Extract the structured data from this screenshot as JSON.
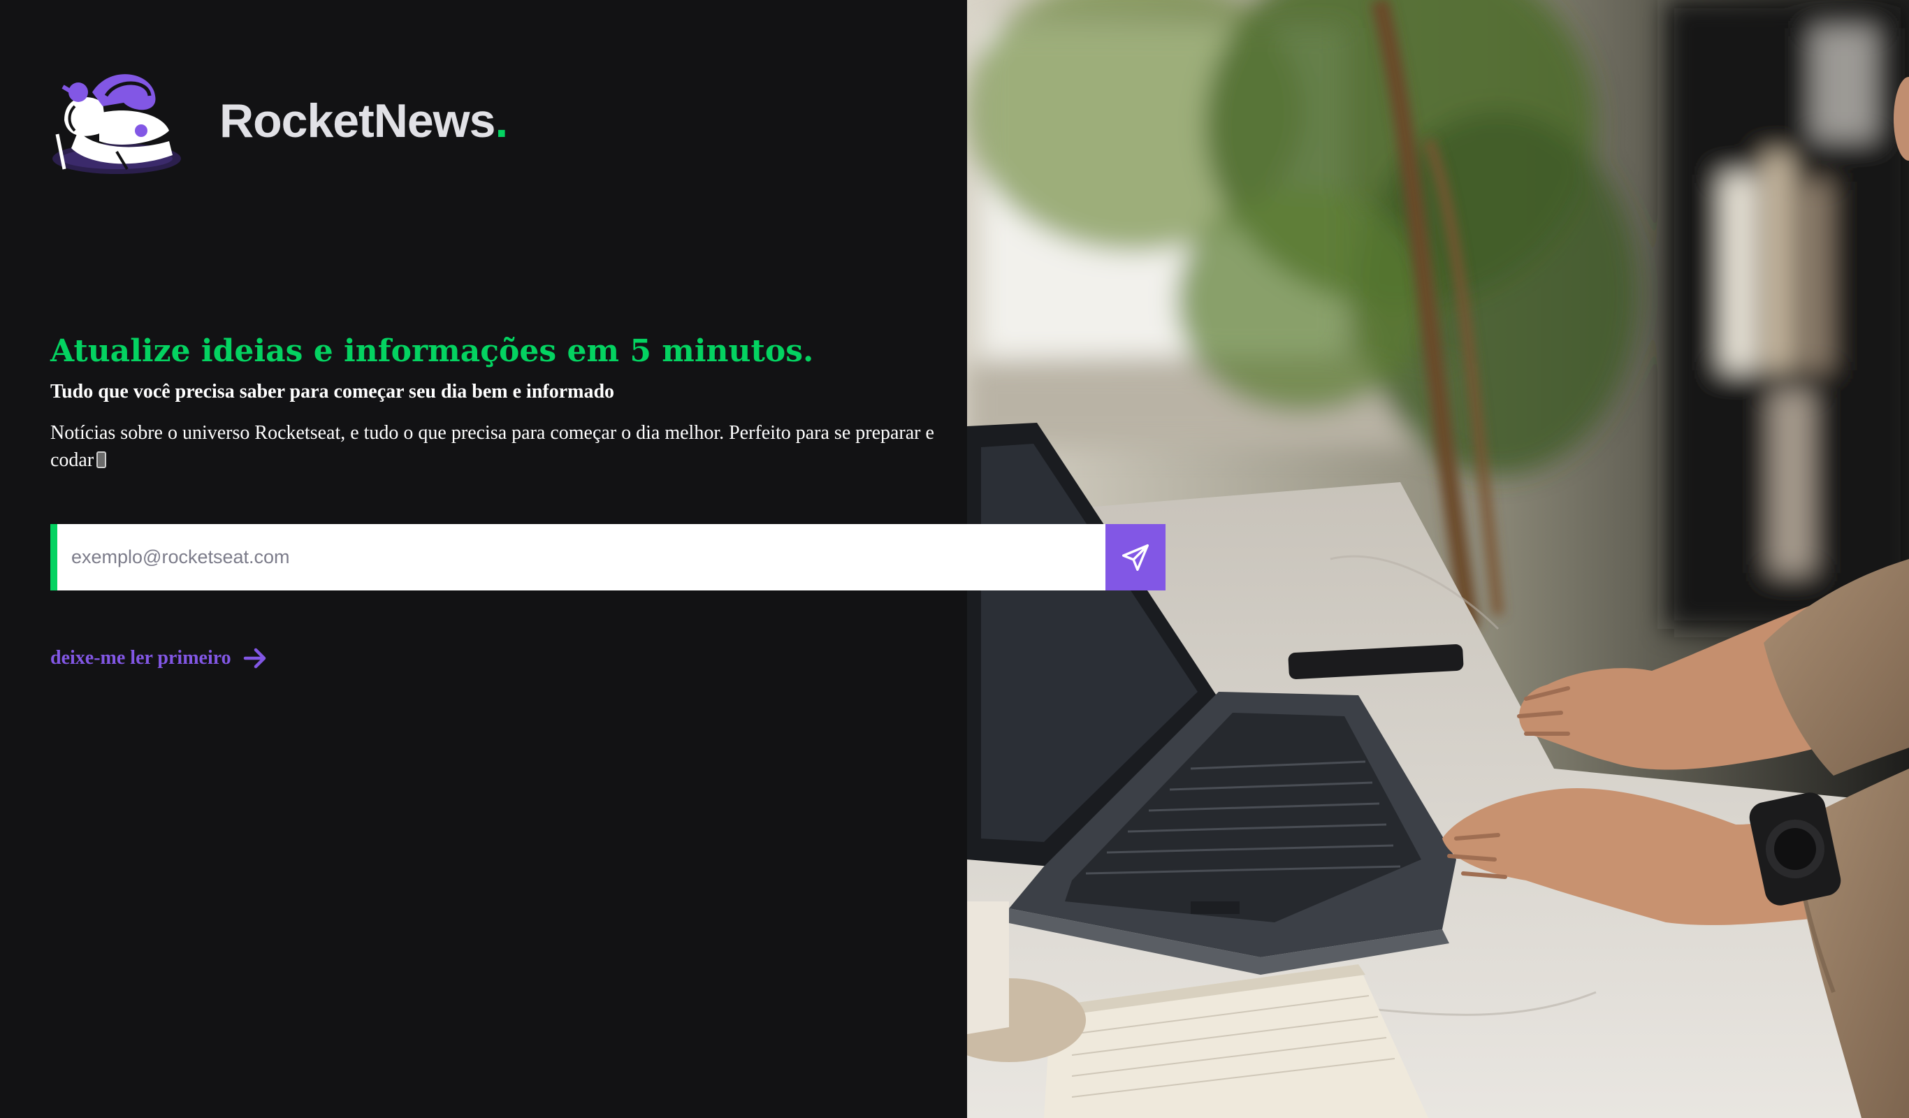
{
  "brand": {
    "name": "RocketNews",
    "dot": "."
  },
  "hero": {
    "headline": "Atualize ideias e informações em 5 minutos.",
    "subheadline": "Tudo que você precisa saber para começar seu dia bem e informado",
    "description": "Notícias sobre o universo Rocketseat, e tudo o que precisa para começar o dia melhor. Perfeito para se preparar e codar"
  },
  "form": {
    "email_placeholder": "exemplo@rocketseat.com",
    "email_value": "",
    "submit_icon": "send-icon"
  },
  "links": {
    "read_first": "deixe-me ler primeiro",
    "read_first_icon": "arrow-right-icon"
  },
  "icons": {
    "logo": "astronaut-mascot-logo",
    "description_emoji": "mobile-phone-icon"
  },
  "colors": {
    "background": "#121214",
    "accent_green": "#04d361",
    "accent_purple": "#8257e5",
    "text": "#e1e1e6",
    "white": "#ffffff"
  }
}
